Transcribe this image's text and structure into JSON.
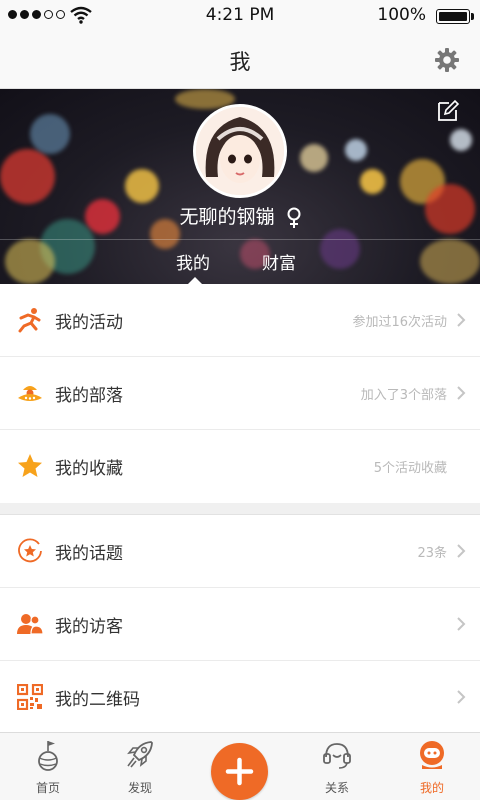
{
  "status_bar": {
    "time": "4:21 PM",
    "battery": "100%"
  },
  "nav": {
    "title": "我"
  },
  "profile": {
    "username": "无聊的钢镚",
    "gender_symbol": "♀"
  },
  "profile_tabs": [
    {
      "label": "我的",
      "active": true
    },
    {
      "label": "财富",
      "active": false
    }
  ],
  "menu": {
    "activities": {
      "label": "我的活动",
      "detail": "参加过16次活动"
    },
    "tribes": {
      "label": "我的部落",
      "detail": "加入了3个部落"
    },
    "favorites": {
      "label": "我的收藏",
      "detail": "5个活动收藏"
    },
    "topics": {
      "label": "我的话题",
      "detail": "23条"
    },
    "visitors": {
      "label": "我的访客",
      "detail": ""
    },
    "qrcode": {
      "label": "我的二维码",
      "detail": ""
    }
  },
  "tabbar": {
    "home": "首页",
    "discover": "发现",
    "relations": "关系",
    "mine": "我的"
  },
  "colors": {
    "accent": "#ef6a26",
    "star": "#f7a21b"
  }
}
